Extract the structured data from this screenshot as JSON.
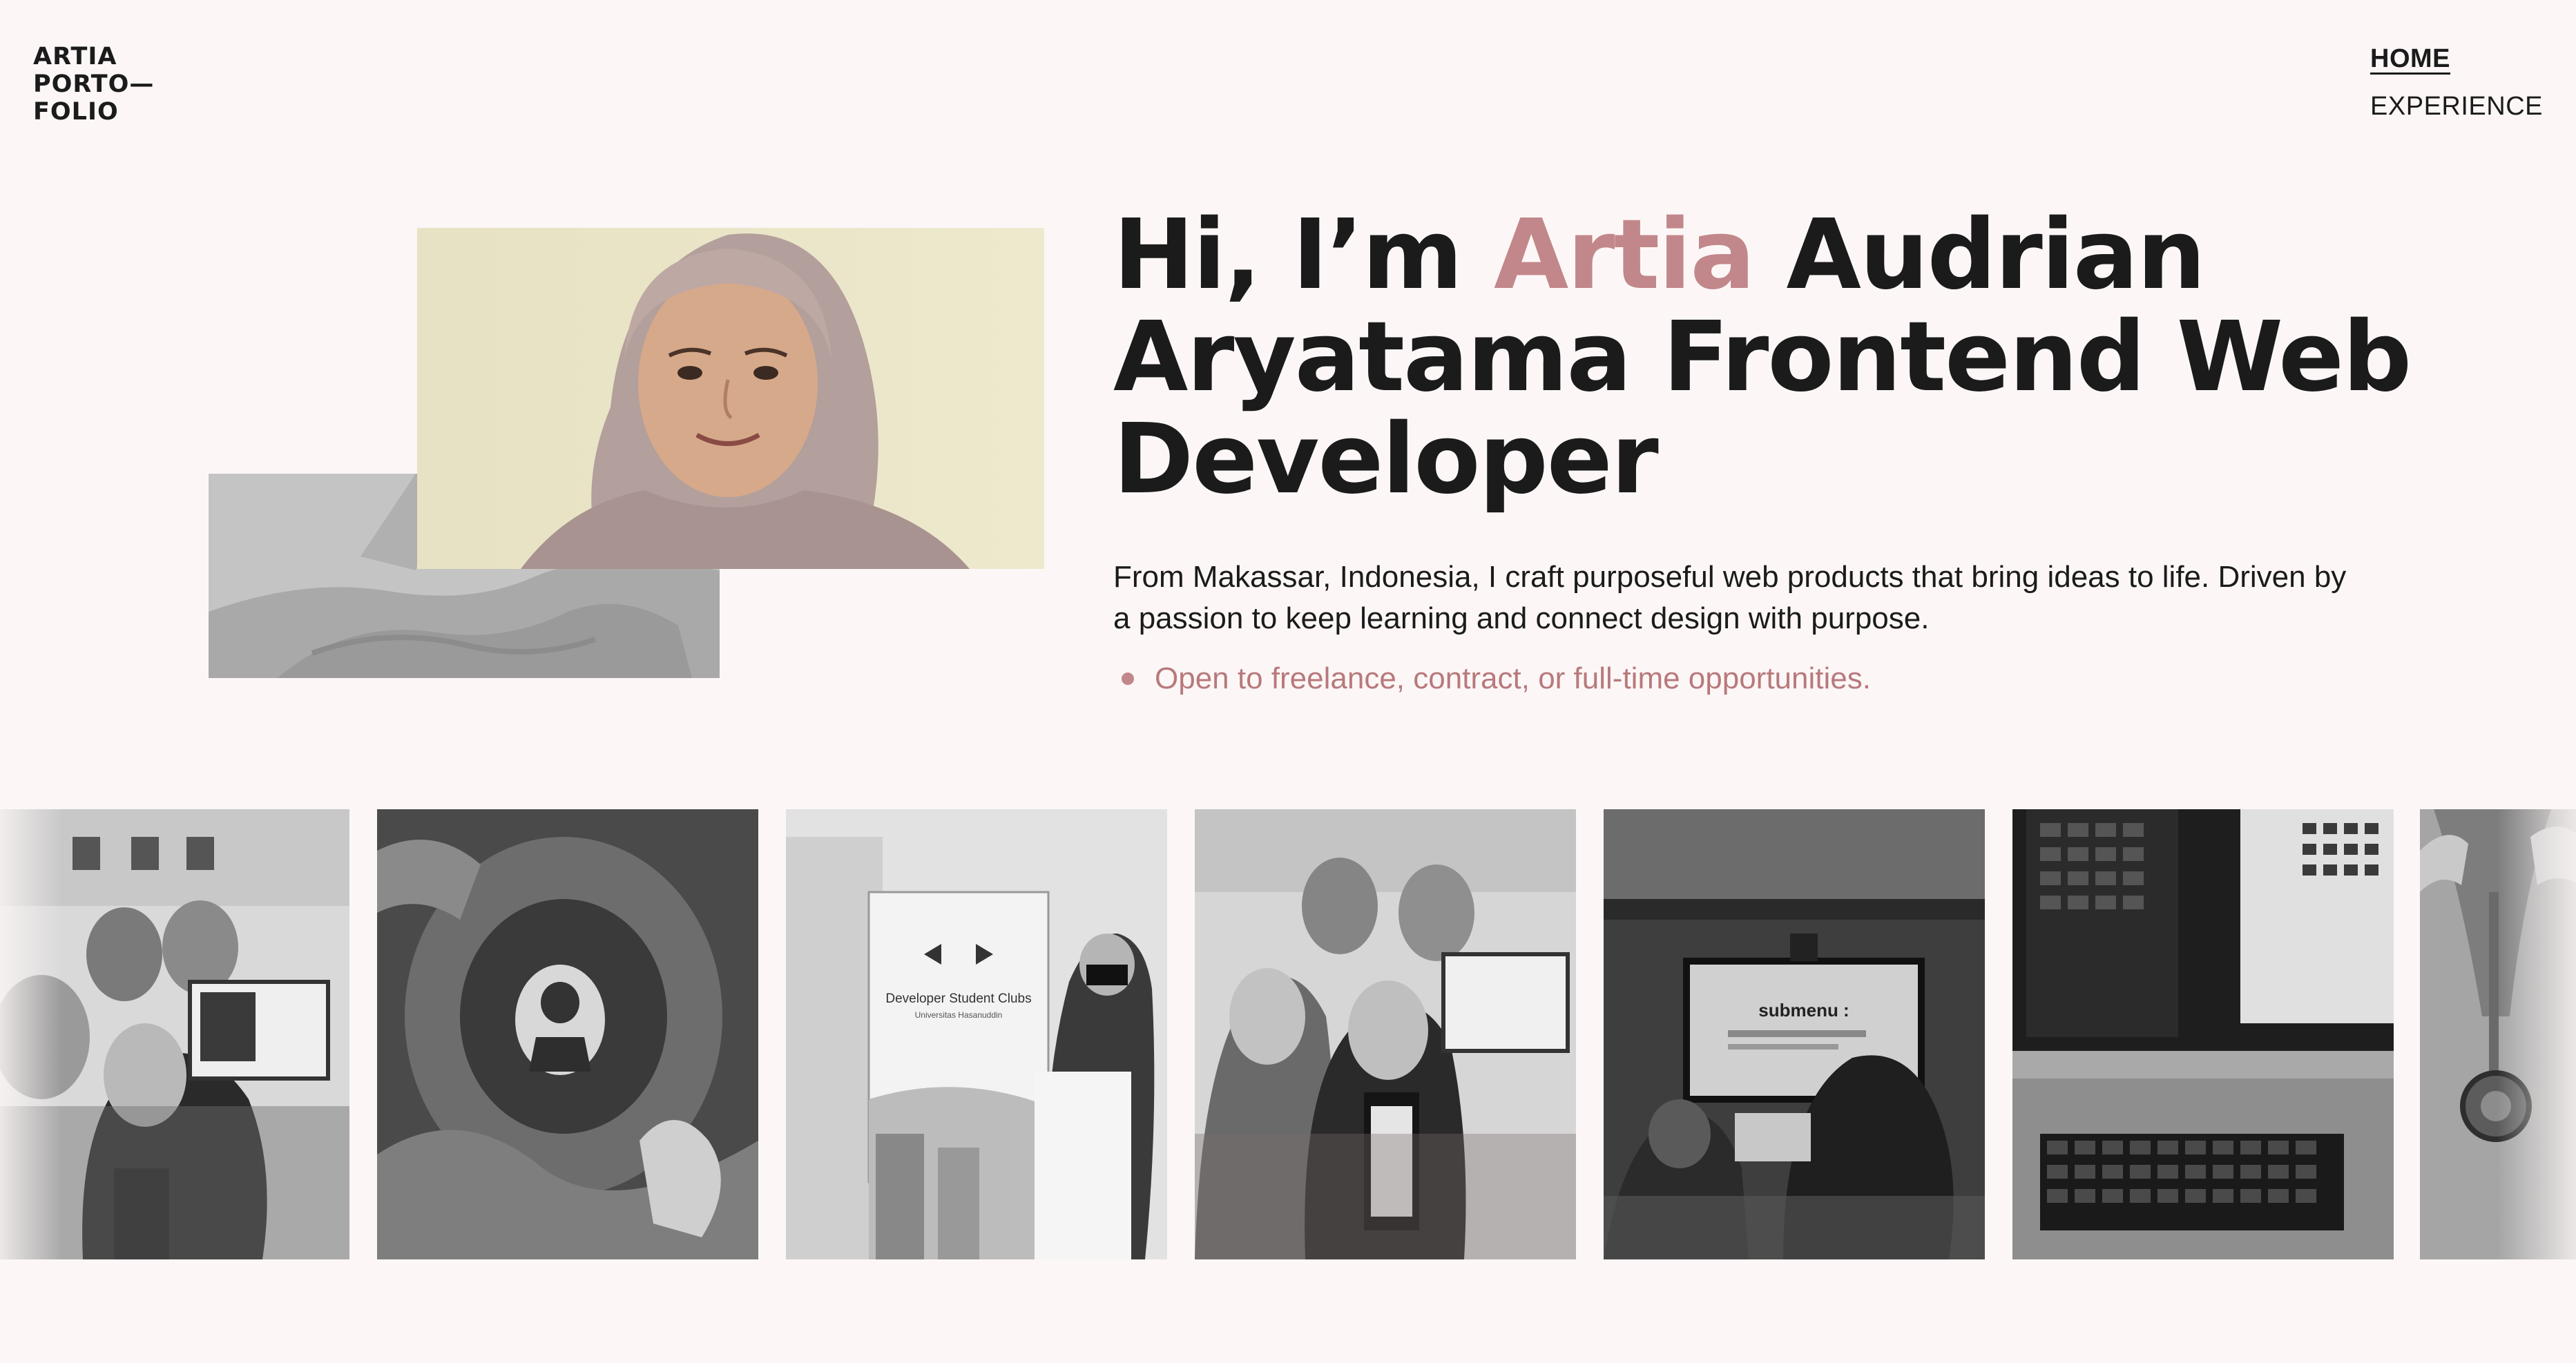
{
  "logo": {
    "line1": "ARTIA",
    "line2": "PORTO—",
    "line3": "FOLIO"
  },
  "nav": {
    "items": [
      {
        "label": "HOME",
        "active": true
      },
      {
        "label": "EXPERIENCE",
        "active": false
      }
    ]
  },
  "hero": {
    "headline_prefix": "Hi, I’m ",
    "headline_accent": "Artia",
    "headline_suffix": " Audrian Aryatama Frontend Web Developer",
    "intro": "From Makassar, Indonesia, I craft purposeful web products that bring ideas to life. Driven by a passion to keep learning and connect design with purpose.",
    "availability": "Open to freelance, contract, or full-time opportunities."
  },
  "gallery": {
    "tile3_sign": "Developer Student Clubs",
    "tile3_sub": "Universitas Hasanuddin",
    "tile5_screen": "submenu :"
  },
  "colors": {
    "background": "#fcf7f6",
    "accent": "#c2878a",
    "text": "#1b1b1b"
  }
}
